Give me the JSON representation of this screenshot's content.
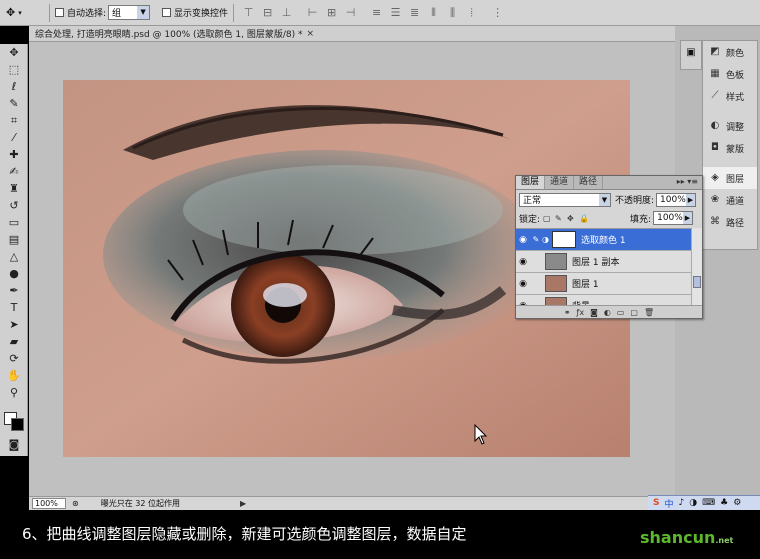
{
  "options_bar": {
    "auto_select_label": "自动选择:",
    "auto_select_value": "组",
    "show_transform_label": "显示变换控件",
    "align_icons": [
      "align-top-icon",
      "align-vcenter-icon",
      "align-bottom-icon",
      "align-left-icon",
      "align-hcenter-icon",
      "align-right-icon",
      "distribute-top-icon",
      "distribute-vcenter-icon",
      "distribute-bottom-icon",
      "distribute-left-icon",
      "distribute-hcenter-icon",
      "distribute-right-icon",
      "auto-align-icon"
    ]
  },
  "document": {
    "tab_title": "综合处理, 打造明亮眼睛.psd @ 100% (选取颜色 1, 图层蒙版/8) *",
    "close": "×"
  },
  "status": {
    "zoom": "100%",
    "info": "曝光只在 32 位起作用",
    "arrow": "▶"
  },
  "dock": {
    "items": [
      {
        "label": "颜色",
        "icon": "color-icon"
      },
      {
        "label": "色板",
        "icon": "swatches-icon"
      },
      {
        "label": "样式",
        "icon": "styles-icon"
      },
      {
        "label": "调整",
        "icon": "adjustments-icon"
      },
      {
        "label": "蒙版",
        "icon": "masks-icon"
      },
      {
        "label": "图层",
        "icon": "layers-icon"
      },
      {
        "label": "通道",
        "icon": "channels-icon"
      },
      {
        "label": "路径",
        "icon": "paths-icon"
      }
    ]
  },
  "layers_panel": {
    "tabs": [
      "图层",
      "通道",
      "路径"
    ],
    "blend_mode": "正常",
    "opacity_label": "不透明度:",
    "opacity_value": "100%",
    "lock_label": "锁定:",
    "fill_label": "填充:",
    "fill_value": "100%",
    "layers": [
      {
        "name": "选取颜色 1",
        "selected": true
      },
      {
        "name": "图层 1 副本",
        "selected": false
      },
      {
        "name": "图层 1",
        "selected": false
      },
      {
        "name": "背景",
        "selected": false
      }
    ]
  },
  "tray": {
    "items": [
      "S",
      "中",
      "♪",
      "◑",
      "⌨",
      "♣",
      "⚙"
    ]
  },
  "caption": {
    "text": "6、把曲线调整图层隐藏或删除，新建可选颜色调整图层，数据自定"
  },
  "watermark": {
    "text": "shancun",
    "suffix": ".net"
  },
  "colors": {
    "selected_layer": "#3a6ed6",
    "watermark": "#5cb82e"
  }
}
